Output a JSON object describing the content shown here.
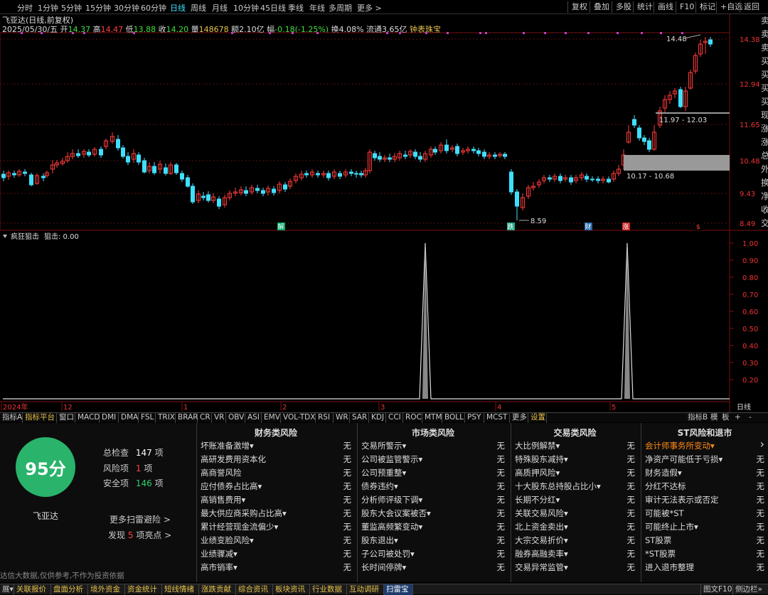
{
  "topbar": {
    "periods": [
      "分时",
      "1分钟",
      "5分钟",
      "15分钟",
      "30分钟",
      "60分钟",
      "日线",
      "周线",
      "月线",
      "10分钟",
      "45日线",
      "季线",
      "年线",
      "多周期",
      "更多 >"
    ],
    "selected": "日线",
    "right_buttons": [
      "复权",
      "叠加",
      "多股",
      "统计",
      "画线",
      "F10",
      "标记",
      "+自选",
      "返回"
    ]
  },
  "stock": {
    "title": "飞亚达(日线,前复权)",
    "date": "2025/05/30/五",
    "open_label": "开",
    "open": "14.37",
    "high_label": "高",
    "high": "14.47",
    "low_label": "低",
    "low": "13.88",
    "close_label": "收",
    "close": "14.20",
    "vol_label": "量",
    "vol": "148678",
    "amount_label": "额",
    "amount": "2.10亿",
    "change_label": "幅",
    "change": "-0.18(-1.25%)",
    "turnover_label": "换",
    "turnover": "4.08%",
    "float_label": "流通",
    "float": "3.65亿",
    "gem": "钟表珠宝"
  },
  "price_axis": [
    "14.38",
    "12.94",
    "11.65",
    "10.48",
    "9.43",
    "8.49"
  ],
  "annotations": {
    "high_mark": "14.48",
    "low_mark": "8.59",
    "zone_upper": "11.97 - 12.03",
    "zone_lower": "10.17 - 10.68"
  },
  "event_markers": [
    "解",
    "跌",
    "财",
    "涨",
    "$"
  ],
  "indicator": {
    "name": "疯狂狙击",
    "value_label": "狙击: 0.00"
  },
  "osc_axis": [
    "1.00",
    "0.90",
    "0.80",
    "0.70",
    "0.60",
    "0.50",
    "0.40",
    "0.30",
    "0.20"
  ],
  "time_axis": [
    "2024年",
    "12",
    "1",
    "2",
    "3",
    "4",
    "5"
  ],
  "period_label": "日线",
  "right_strip": [
    "卖",
    "卖",
    "卖",
    "买",
    "买",
    "买",
    "买",
    "现",
    "涨",
    "涨",
    "总",
    "外",
    "换",
    "净",
    "收",
    "交"
  ],
  "indicator_tabs": [
    "指标A",
    "指标平台",
    "窗口",
    "MACD",
    "DMI",
    "DMA",
    "FSL",
    "TRIX",
    "BRAR",
    "CR",
    "VR",
    "OBV",
    "ASI",
    "EMV",
    "VOL-TDX",
    "RSI",
    "WR",
    "SAR",
    "KDJ",
    "CCI",
    "ROC",
    "MTM",
    "BOLL",
    "PSY",
    "MCST",
    "更多",
    "设置"
  ],
  "indicator_tabs_right": [
    "指标B",
    "模",
    "板",
    "+",
    "-"
  ],
  "scan": {
    "score": "95分",
    "name": "飞亚达",
    "total_label": "总检查",
    "total": "147",
    "unit": "项",
    "risk_label": "风险项",
    "risk": "1",
    "safe_label": "安全项",
    "safe": "146",
    "more_link": "更多扫雷避险 >",
    "found_prefix": "发现",
    "found_count": "5",
    "found_suffix": "项亮点 >",
    "disclaimer": "达信大数据,仅供参考,不作为投资依据"
  },
  "categories": [
    {
      "title": "财务类风险",
      "items": [
        "坏账准备激增▾",
        "高研发费用资本化",
        "高商誉风险",
        "应付债券占比高▾",
        "高销售费用▾",
        "最大供应商采购占比高▾",
        "累计经营现金流偏少▾",
        "业绩变脸风险▾",
        "业绩骤减▾",
        "高市销率▾"
      ]
    },
    {
      "title": "市场类风险",
      "items": [
        "交易所警示▾",
        "公司被监管警示▾",
        "公司预重整▾",
        "债券违约▾",
        "分析师评级下调▾",
        "股东大会议案被否▾",
        "董监高频繁变动▾",
        "股东退出▾",
        "子公司被处罚▾",
        "长时间停牌▾"
      ]
    },
    {
      "title": "交易类风险",
      "items": [
        "大比例解禁▾",
        "特殊股东减持▾",
        "高质押风险▾",
        "十大股东总持股占比小▾",
        "长期不分红▾",
        "关联交易风险▾",
        "北上资金卖出▾",
        "大宗交易折价▾",
        "融券高融卖率▾",
        "交易异常监管▾"
      ]
    },
    {
      "title": "ST风险和退市",
      "items": [
        "会计师事务所变动▾",
        "净资产可能低于亏损▾",
        "财务造假▾",
        "分红不达标",
        "审计无法表示或否定",
        "可能被*ST",
        "可能终止上市▾",
        "ST股票",
        "*ST股票",
        "进入退市整理"
      ]
    }
  ],
  "none_label": "无",
  "bottom_tabs": [
    "展▾",
    "关联报价",
    "盘面分析",
    "境外资金",
    "资金统计",
    "短线情绪",
    "涨跌贡献",
    "综合资讯",
    "板块资讯",
    "行业数据",
    "互动调研",
    "扫雷宝"
  ],
  "bottom_right": [
    "图文F10",
    "侧边栏»"
  ],
  "colors": {
    "up": "#ff3b3b",
    "down": "#3fe0ff",
    "score_bg": "#29b36b",
    "gold": "#e6c34a"
  }
}
